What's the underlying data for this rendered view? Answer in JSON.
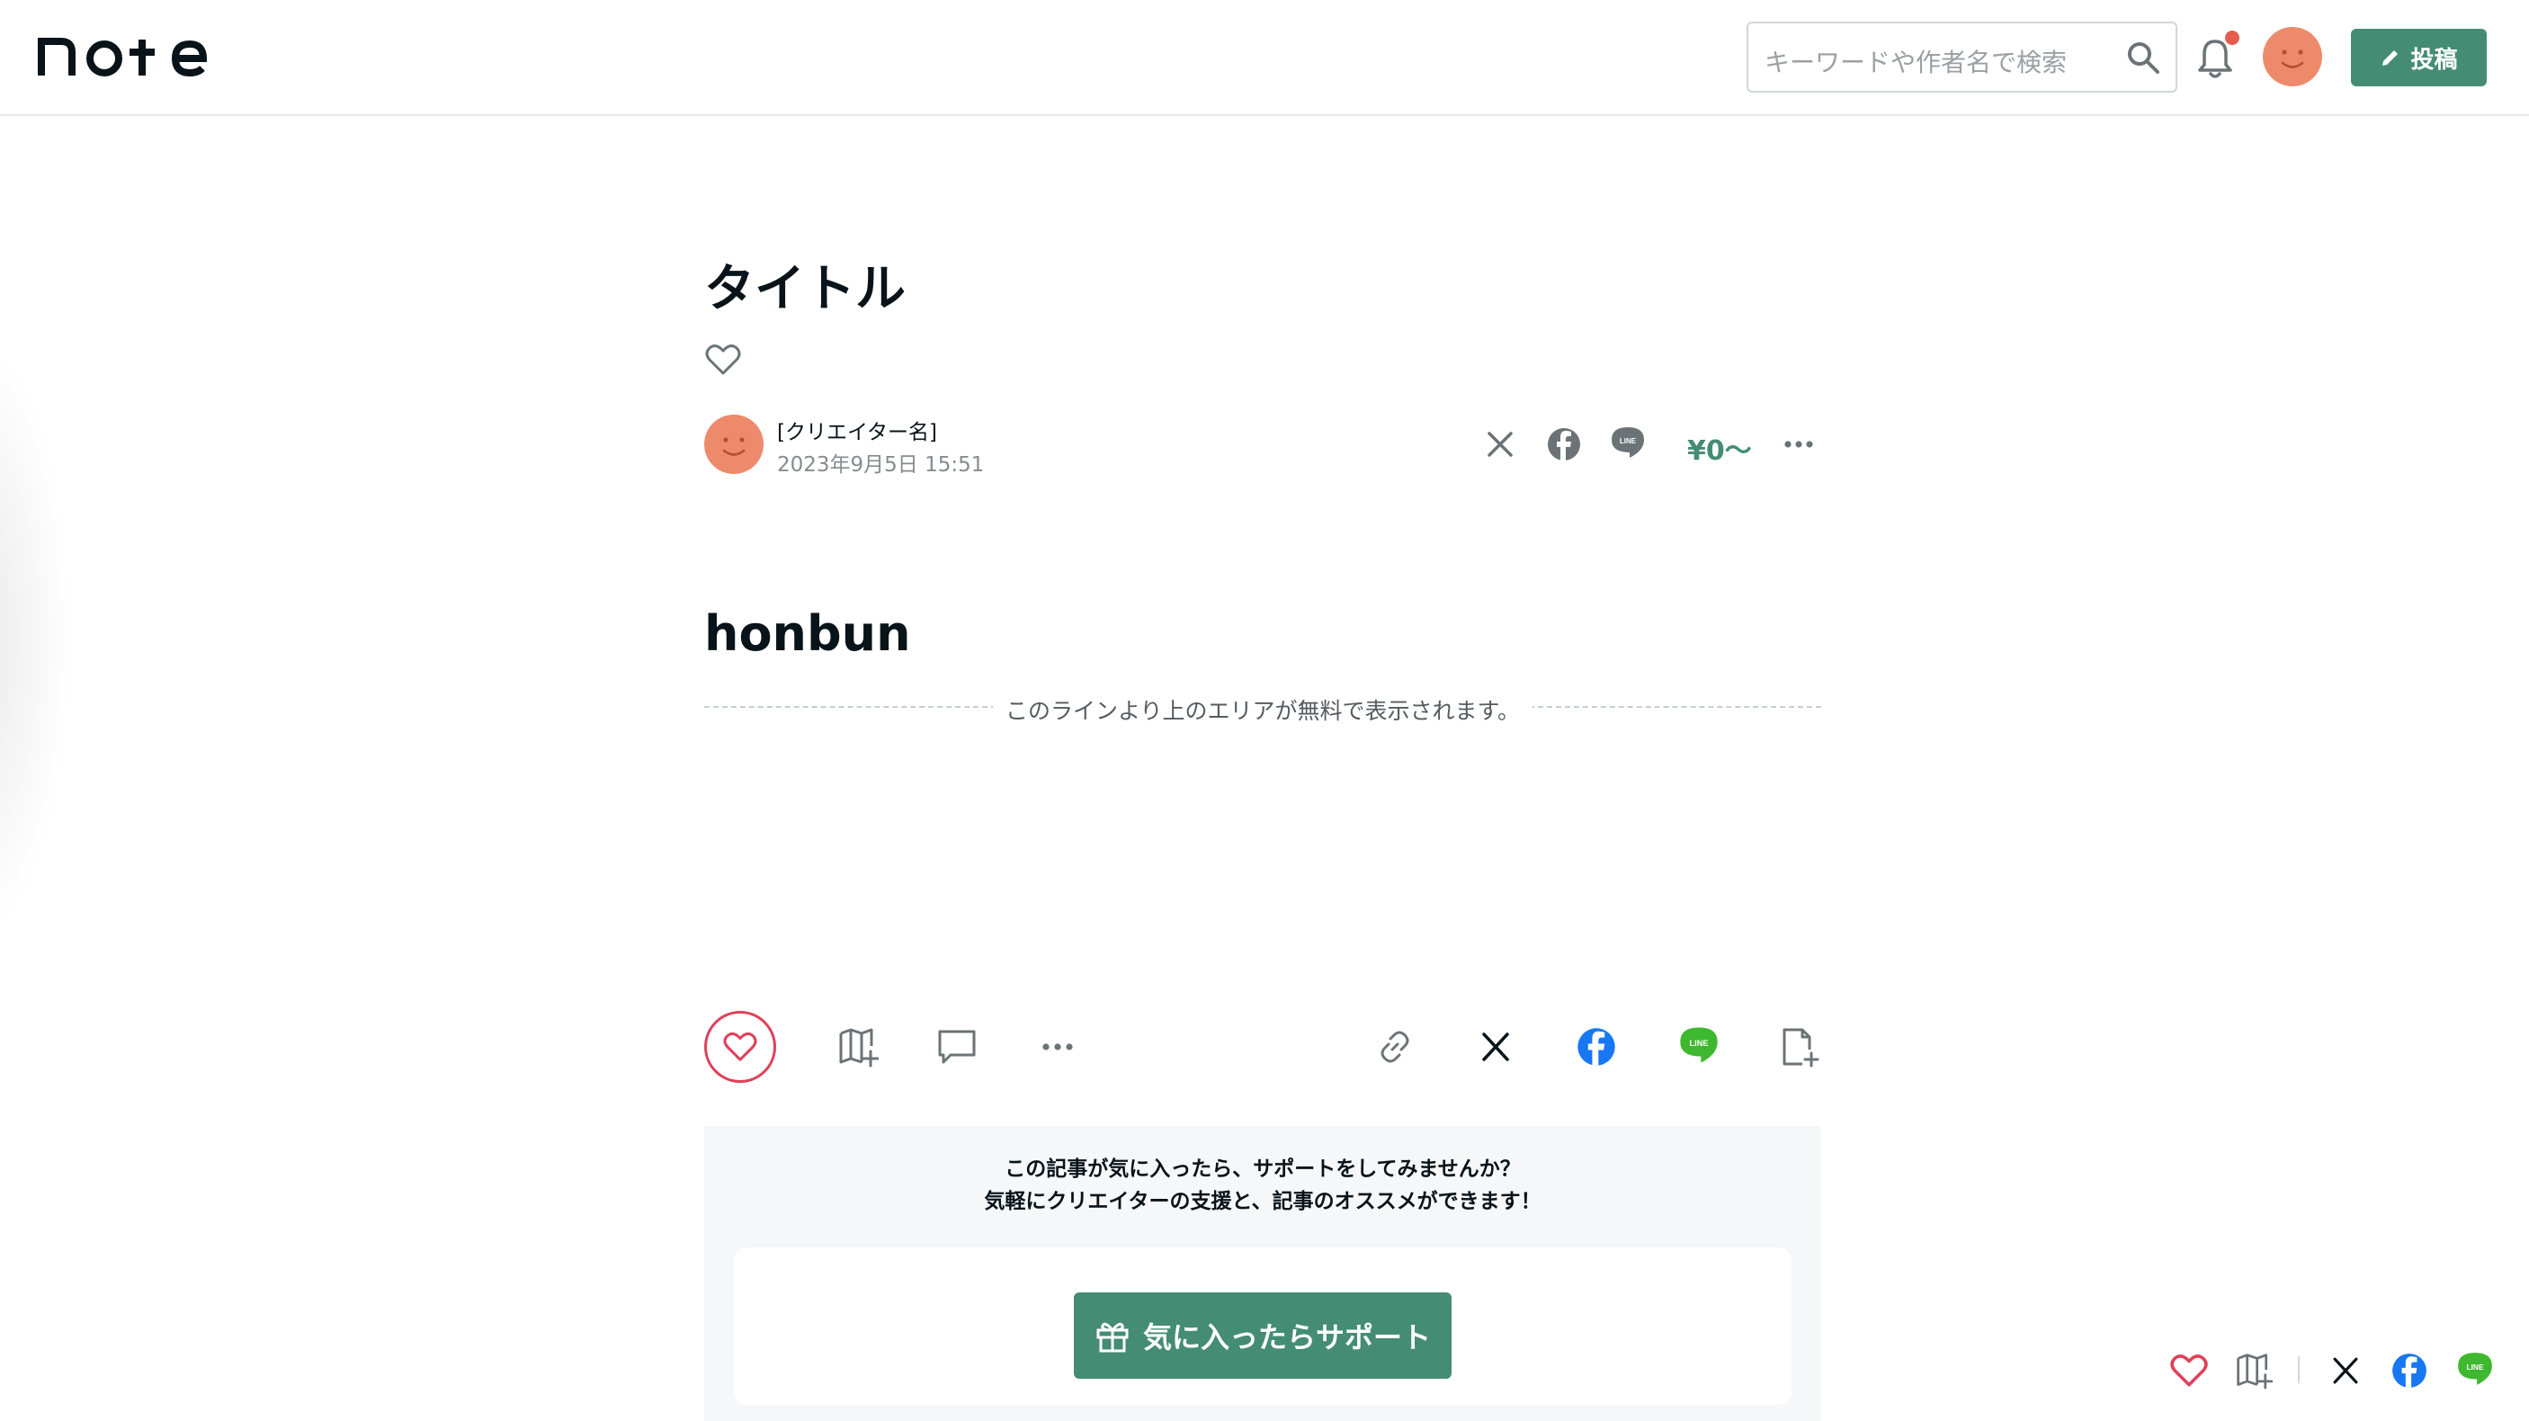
{
  "header": {
    "logo_text": "note",
    "search": {
      "placeholder": "キーワードや作者名で検索",
      "icon": "search-icon"
    },
    "notifications": {
      "icon": "bell-icon",
      "has_unread": true
    },
    "avatar": {
      "icon": "smiley-avatar"
    },
    "post_button": {
      "label": "投稿",
      "icon": "pencil-icon"
    }
  },
  "article": {
    "title": "タイトル",
    "author_name": "[クリエイター名]",
    "published": "2023年9月5日 15:51",
    "price": "¥0〜",
    "body": "honbun",
    "free_area_notice": "このラインより上のエリアが無料で表示されます。"
  },
  "meta_share": [
    "x-icon",
    "facebook-icon",
    "line-icon",
    "more-icon"
  ],
  "actions": {
    "left": [
      "heart-icon",
      "add-to-magazine-icon",
      "comment-icon",
      "more-icon"
    ],
    "right": [
      "link-icon",
      "x-icon",
      "facebook-icon",
      "line-icon",
      "embed-icon"
    ]
  },
  "support": {
    "message_line1": "この記事が気に入ったら、サポートをしてみませんか？",
    "message_line2": "気軽にクリエイターの支援と、記事のオススメができます！",
    "button_label": "気に入ったらサポート",
    "button_icon": "gift-icon"
  },
  "floating_share": [
    "heart-icon",
    "add-to-magazine-icon",
    "x-icon",
    "facebook-icon",
    "line-icon"
  ],
  "colors": {
    "brand_green": "#458c74",
    "like_red": "#e0405a",
    "avatar_orange": "#ee8a6c",
    "facebook_blue": "#1877f2",
    "line_green": "#3eb82f",
    "notification_red": "#e35d4f"
  }
}
